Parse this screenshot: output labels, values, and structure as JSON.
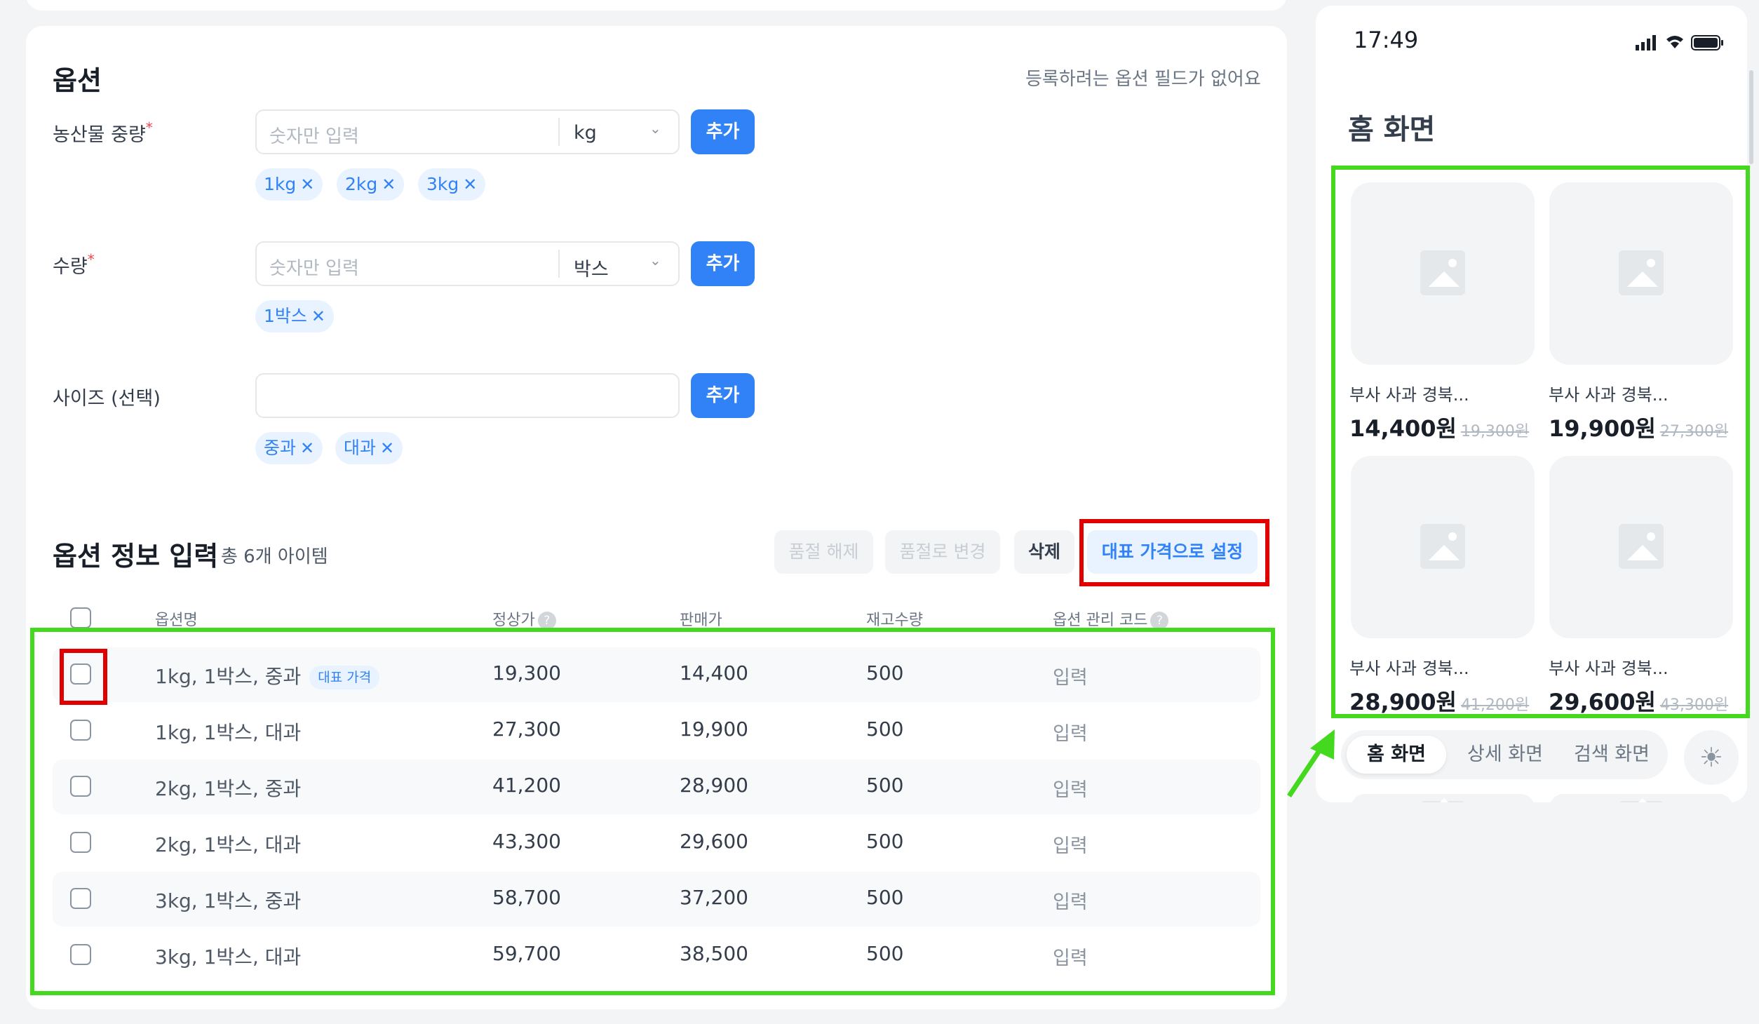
{
  "options_section": {
    "title": "옵션",
    "hint": "등록하려는 옵션 필드가 없어요",
    "add_label": "추가",
    "fields": [
      {
        "label": "농산물 중량",
        "required": "*",
        "placeholder": "숫자만 입력",
        "unit": "kg",
        "chips": [
          "1kg",
          "2kg",
          "3kg"
        ]
      },
      {
        "label": "수량",
        "required": "*",
        "placeholder": "숫자만 입력",
        "unit": "박스",
        "chips": [
          "1박스"
        ]
      },
      {
        "label": "사이즈 (선택)",
        "placeholder": "",
        "chips": [
          "중과",
          "대과"
        ]
      }
    ]
  },
  "option_info": {
    "title": "옵션 정보 입력",
    "count_text": "총 6개 아이템",
    "actions": {
      "release_soldout": "품절 해제",
      "mark_soldout": "품절로 변경",
      "delete": "삭제",
      "set_rep_price": "대표 가격으로 설정"
    },
    "columns": [
      "옵션명",
      "정상가",
      "판매가",
      "재고수량",
      "옵션 관리 코드"
    ],
    "rep_badge": "대표 가격",
    "rows": [
      {
        "name": "1kg, 1박스, 중과",
        "list_price": "19,300",
        "sale_price": "14,400",
        "stock": "500",
        "code": "입력",
        "rep": true
      },
      {
        "name": "1kg, 1박스, 대과",
        "list_price": "27,300",
        "sale_price": "19,900",
        "stock": "500",
        "code": "입력"
      },
      {
        "name": "2kg, 1박스, 중과",
        "list_price": "41,200",
        "sale_price": "28,900",
        "stock": "500",
        "code": "입력"
      },
      {
        "name": "2kg, 1박스, 대과",
        "list_price": "43,300",
        "sale_price": "29,600",
        "stock": "500",
        "code": "입력"
      },
      {
        "name": "3kg, 1박스, 중과",
        "list_price": "58,700",
        "sale_price": "37,200",
        "stock": "500",
        "code": "입력"
      },
      {
        "name": "3kg, 1박스, 대과",
        "list_price": "59,700",
        "sale_price": "38,500",
        "stock": "500",
        "code": "입력"
      }
    ]
  },
  "phone": {
    "time": "17:49",
    "title": "홈 화면",
    "products": [
      {
        "name": "부사 사과 경북...",
        "price": "14,400원",
        "original": "19,300원"
      },
      {
        "name": "부사 사과 경북...",
        "price": "19,900원",
        "original": "27,300원"
      },
      {
        "name": "부사 사과 경북...",
        "price": "28,900원",
        "original": "41,200원"
      },
      {
        "name": "부사 사과 경북...",
        "price": "29,600원",
        "original": "43,300원"
      }
    ],
    "tabs": [
      "홈 화면",
      "상세 화면",
      "검색 화면"
    ],
    "theme_icon": "sun-icon"
  },
  "colors": {
    "primary": "#3182f6",
    "highlight_red": "#e00000",
    "highlight_green": "#44d81f"
  }
}
